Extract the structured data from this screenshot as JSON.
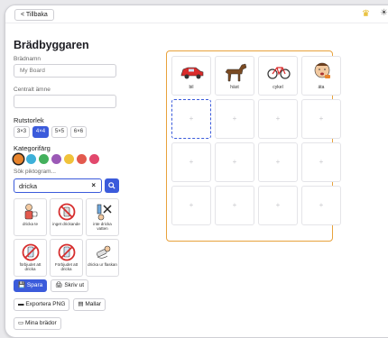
{
  "topbar": {
    "back_label": "< Tillbaka"
  },
  "builder": {
    "title": "Brädbyggaren",
    "board_name_label": "Brädnamn",
    "board_name_placeholder": "My Board",
    "topic_label": "Centralt ämne",
    "topic_placeholder": "",
    "grid_size_label": "Rutstorlek",
    "grid_sizes": [
      "3×3",
      "4×4",
      "5×5",
      "6×6"
    ],
    "selected_grid_size": "4×4",
    "category_color_label": "Kategorifärg",
    "category_colors": [
      "#e8842c",
      "#3db0d9",
      "#43b05c",
      "#9b59b6",
      "#f0c23a",
      "#e35a4e",
      "#e2486c"
    ],
    "selected_color": "#e8842c",
    "search_label": "Sök piktogram...",
    "search_value": "dricka",
    "results": [
      {
        "label": "dricka te",
        "icon": "drink-tea-icon"
      },
      {
        "label": "inget drickande",
        "icon": "no-drinking-icon"
      },
      {
        "label": "inte dricka vatten",
        "icon": "no-water-icon"
      },
      {
        "label": "förbjudet att dricka",
        "icon": "forbidden-drink-icon"
      },
      {
        "label": "Förbjudet att dricka",
        "icon": "forbidden-drink-icon"
      },
      {
        "label": "dricka ur flaskan",
        "icon": "drink-bottle-icon"
      }
    ],
    "actions": {
      "save": "Spara",
      "print": "Skriv ut",
      "export_png": "Exportera PNG",
      "templates": "Mallar",
      "my_boards": "Mina brädor"
    }
  },
  "board": {
    "cells": [
      {
        "label": "bil",
        "icon": "car-icon"
      },
      {
        "label": "häst",
        "icon": "horse-icon"
      },
      {
        "label": "cykel",
        "icon": "bicycle-icon"
      },
      {
        "label": "äta",
        "icon": "eat-icon"
      }
    ],
    "empty_symbol": "+"
  }
}
